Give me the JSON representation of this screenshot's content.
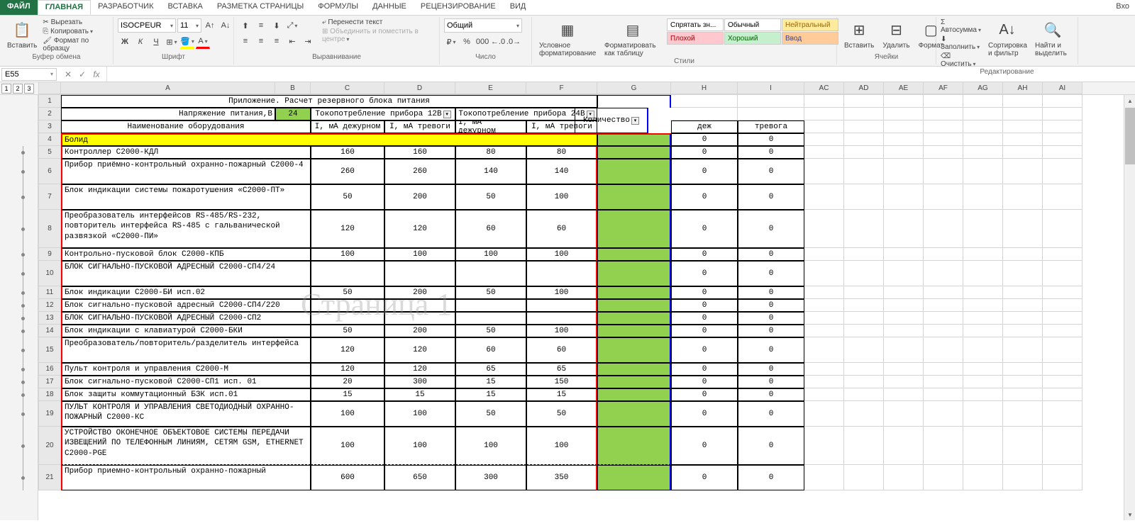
{
  "menu": {
    "file": "ФАЙЛ",
    "tabs": [
      "ГЛАВНАЯ",
      "Разработчик",
      "ВСТАВКА",
      "РАЗМЕТКА СТРАНИЦЫ",
      "ФОРМУЛЫ",
      "ДАННЫЕ",
      "РЕЦЕНЗИРОВАНИЕ",
      "ВИД"
    ],
    "login": "Вхо"
  },
  "ribbon": {
    "clipboard": {
      "paste": "Вставить",
      "cut": "Вырезать",
      "copy": "Копировать",
      "painter": "Формат по образцу",
      "label": "Буфер обмена"
    },
    "font": {
      "name": "ISOCPEUR",
      "size": "11",
      "label": "Шрифт"
    },
    "align": {
      "wrap": "Перенести текст",
      "merge": "Объединить и поместить в центре",
      "label": "Выравнивание"
    },
    "number": {
      "format": "Общий",
      "label": "Число"
    },
    "styles": {
      "cond": "Условное форматирование",
      "table": "Форматировать как таблицу",
      "hide": "Спрятать зн...",
      "normal": "Обычный",
      "neutral": "Нейтральный",
      "bad": "Плохой",
      "good": "Хороший",
      "input": "Ввод",
      "label": "Стили"
    },
    "cells": {
      "insert": "Вставить",
      "delete": "Удалить",
      "format": "Формат",
      "label": "Ячейки"
    },
    "editing": {
      "autosum": "Автосумма",
      "fill": "Заполнить",
      "clear": "Очистить",
      "sort": "Сортировка и фильтр",
      "find": "Найти и выделить",
      "label": "Редактирование"
    }
  },
  "namebox": "E55",
  "outline_levels": [
    "1",
    "2",
    "3"
  ],
  "columns_visible": [
    "A",
    "B",
    "C",
    "D",
    "E",
    "F",
    "G",
    "H",
    "I",
    "AC",
    "AD",
    "AE",
    "AF",
    "AG",
    "AH",
    "AI"
  ],
  "watermark": "Страница 1",
  "sheet": {
    "row1": {
      "title": "Приложение. Расчет резервного блока питания"
    },
    "row2": {
      "voltage_label": "Напряжение питания,В",
      "voltage_value": "24",
      "head12": "Токопотребление прибора 12В",
      "head24": "Токопотребление прибора 24В",
      "qty": "Количество"
    },
    "row3": {
      "name": "Наименование оборудования",
      "i1": "I, мА дежурном",
      "i2": "I, мА тревоги",
      "i3": "I, мА дежурном",
      "i4": "I, мА тревоги",
      "h": "деж",
      "i": "тревога"
    },
    "row4": {
      "a": "Болид"
    },
    "data_rows": [
      {
        "n": 5,
        "a": "Контроллер С2000-КДЛ",
        "c": "160",
        "d": "160",
        "e": "80",
        "f": "80",
        "h": "0",
        "i": "0",
        "lines": 1
      },
      {
        "n": 6,
        "a": "Прибор приёмно-контрольный охранно-пожарный С2000-4",
        "c": "260",
        "d": "260",
        "e": "140",
        "f": "140",
        "h": "0",
        "i": "0",
        "lines": 2
      },
      {
        "n": 7,
        "a": "Блок индикации системы пожаротушения «С2000-ПТ»",
        "c": "50",
        "d": "200",
        "e": "50",
        "f": "100",
        "h": "0",
        "i": "0",
        "lines": 2
      },
      {
        "n": 8,
        "a": "Преобразователь интерфейсов RS-485/RS-232, повторитель интерфейса RS-485 с гальванической развязкой «С2000-ПИ»",
        "c": "120",
        "d": "120",
        "e": "60",
        "f": "60",
        "h": "0",
        "i": "0",
        "lines": 3
      },
      {
        "n": 9,
        "a": "Контрольно-пусковой блок С2000-КПБ",
        "c": "100",
        "d": "100",
        "e": "100",
        "f": "100",
        "h": "0",
        "i": "0",
        "lines": 1
      },
      {
        "n": 10,
        "a": "БЛОК СИГНАЛЬНО-ПУСКОВОЙ АДРЕСНЫЙ С2000-СП4/24",
        "c": "",
        "d": "",
        "e": "",
        "f": "",
        "h": "0",
        "i": "0",
        "lines": 2
      },
      {
        "n": 11,
        "a": "Блок индикации С2000-БИ исп.02",
        "c": "50",
        "d": "200",
        "e": "50",
        "f": "100",
        "h": "0",
        "i": "0",
        "lines": 1
      },
      {
        "n": 12,
        "a": "Блок сигнально-пусковой адресный С2000-СП4/220",
        "c": "",
        "d": "",
        "e": "",
        "f": "",
        "h": "0",
        "i": "0",
        "lines": 1
      },
      {
        "n": 13,
        "a": "БЛОК СИГНАЛЬНО-ПУСКОВОЙ АДРЕСНЫЙ С2000-СП2",
        "c": "",
        "d": "",
        "e": "",
        "f": "",
        "h": "0",
        "i": "0",
        "lines": 1
      },
      {
        "n": 14,
        "a": "Блок индикации с клавиатурой С2000-БКИ",
        "c": "50",
        "d": "200",
        "e": "50",
        "f": "100",
        "h": "0",
        "i": "0",
        "lines": 1
      },
      {
        "n": 15,
        "a": "Преобразователь/повторитель/разделитель интерфейса",
        "c": "120",
        "d": "120",
        "e": "60",
        "f": "60",
        "h": "0",
        "i": "0",
        "lines": 2
      },
      {
        "n": 16,
        "a": "Пульт контроля и управления С2000-М",
        "c": "120",
        "d": "120",
        "e": "65",
        "f": "65",
        "h": "0",
        "i": "0",
        "lines": 1
      },
      {
        "n": 17,
        "a": "Блок сигнально-пусковой С2000-СП1 исп. 01",
        "c": "20",
        "d": "300",
        "e": "15",
        "f": "150",
        "h": "0",
        "i": "0",
        "lines": 1
      },
      {
        "n": 18,
        "a": "Блок защиты коммутационный БЗК исп.01",
        "c": "15",
        "d": "15",
        "e": "15",
        "f": "15",
        "h": "0",
        "i": "0",
        "lines": 1
      },
      {
        "n": 19,
        "a": "ПУЛЬТ КОНТРОЛЯ И УПРАВЛЕНИЯ СВЕТОДИОДНЫЙ ОХРАННО-ПОЖАРНЫЙ С2000-КС",
        "c": "100",
        "d": "100",
        "e": "50",
        "f": "50",
        "h": "0",
        "i": "0",
        "lines": 2
      },
      {
        "n": 20,
        "a": "УСТРОЙСТВО ОКОНЕЧНОЕ ОБЪЕКТОВОЕ СИСТЕМЫ ПЕРЕДАЧИ ИЗВЕЩЕНИЙ ПО ТЕЛЕФОННЫМ ЛИНИЯМ, СЕТЯМ GSM, ETHERNET С2000-PGE",
        "c": "100",
        "d": "100",
        "e": "100",
        "f": "100",
        "h": "0",
        "i": "0",
        "lines": 3
      },
      {
        "n": 21,
        "a": "Прибор приемно-контрольный охранно-пожарный",
        "c": "600",
        "d": "650",
        "e": "300",
        "f": "350",
        "h": "0",
        "i": "0",
        "lines": 2
      }
    ]
  }
}
